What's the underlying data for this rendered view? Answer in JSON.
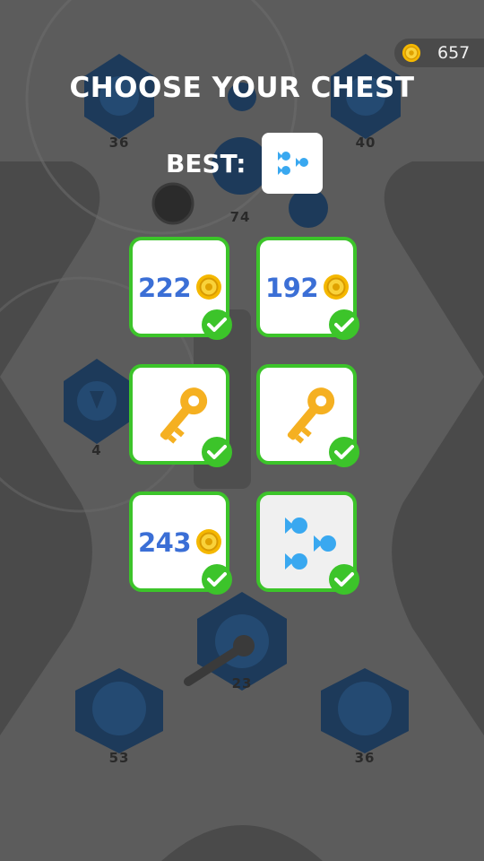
{
  "hud": {
    "coins": "657"
  },
  "title": "CHOOSE YOUR CHEST",
  "best_label": "BEST:",
  "background_labels": [
    "36",
    "40",
    "74",
    "4",
    "23",
    "53",
    "36"
  ],
  "chests": [
    {
      "type": "coins",
      "amount": "222",
      "opened": true
    },
    {
      "type": "coins",
      "amount": "192",
      "opened": true
    },
    {
      "type": "key",
      "opened": true
    },
    {
      "type": "key",
      "opened": true
    },
    {
      "type": "coins",
      "amount": "243",
      "opened": true
    },
    {
      "type": "skin",
      "opened": true
    }
  ],
  "colors": {
    "accent_green": "#3cc42a",
    "amount_blue": "#3b6fd6",
    "coin_gold": "#f5b800",
    "fish_blue": "#39a8f0"
  }
}
